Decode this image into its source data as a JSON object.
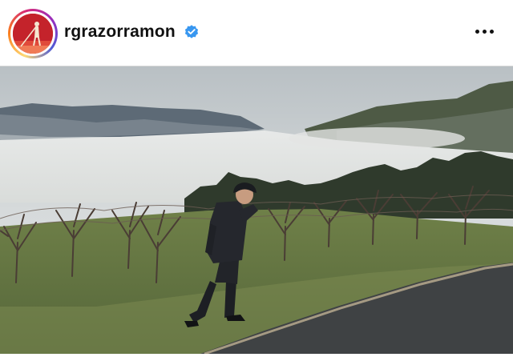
{
  "post": {
    "username": "rgrazorramon",
    "verified": true,
    "avatar_icon": "profile-avatar",
    "more_icon": "more-options-icon",
    "photo_subject": "person-in-orchard-photo"
  },
  "colors": {
    "verified_blue": "#3897f0",
    "avatar_red": "#c4232b"
  }
}
